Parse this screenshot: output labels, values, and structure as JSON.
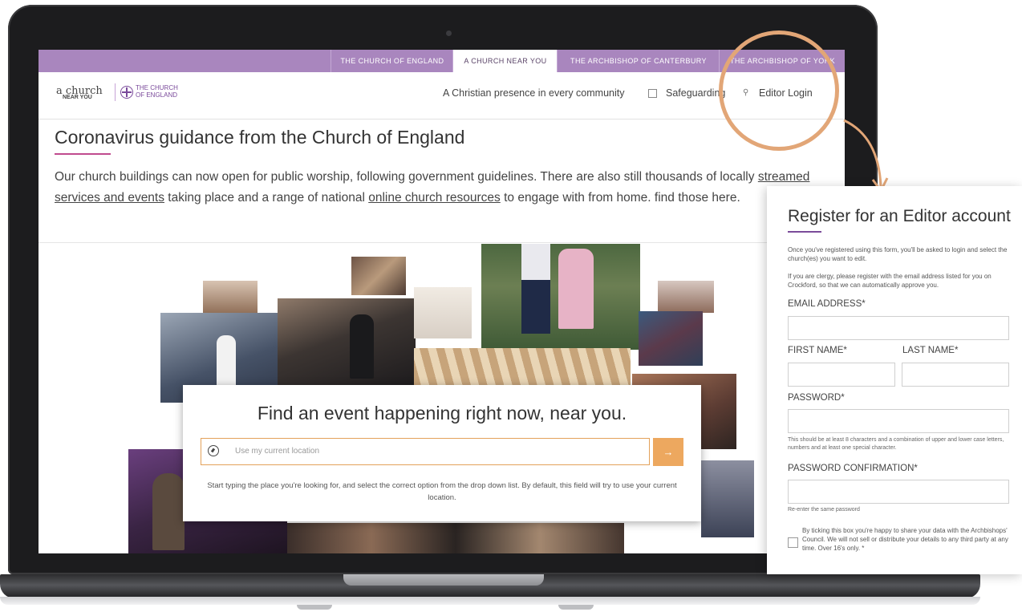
{
  "top_nav": {
    "tabs": [
      "THE CHURCH OF ENGLAND",
      "A CHURCH NEAR YOU",
      "THE ARCHBISHOP OF CANTERBURY",
      "THE ARCHBISHOP OF YORK"
    ],
    "active": "A CHURCH NEAR YOU"
  },
  "header": {
    "logo_main": "a church",
    "logo_sub": "NEAR YOU",
    "coe_logo_line1": "THE CHURCH",
    "coe_logo_line2": "OF ENGLAND",
    "tagline": "A Christian presence in every community",
    "safeguarding_label": "Safeguarding",
    "login_label": "Editor Login"
  },
  "covid": {
    "title": "Coronavirus guidance from the Church of England",
    "text_part1": "Our church buildings can now open for public worship, following government guidelines. There are also still thousands of locally ",
    "link1": "streamed services and events",
    "text_part2": " taking place and a range of national ",
    "link2": "online church resources",
    "text_part3": " to engage with from home. find those here."
  },
  "finder": {
    "title": "Find an event happening right now, near you.",
    "placeholder": "Use my current location",
    "go_icon": "→",
    "hint": "Start typing the place you're looking for, and select the correct option from the drop down list. By default, this field will try to use your current location."
  },
  "register": {
    "title": "Register for an Editor account",
    "intro1": "Once you've registered using this form, you'll be asked to login and select the church(es) you want to edit.",
    "intro2": "If you are clergy, please register with the email address listed for you on Crockford, so that we can automatically approve you.",
    "email_label": "EMAIL ADDRESS*",
    "first_name_label": "FIRST NAME*",
    "last_name_label": "LAST NAME*",
    "password_label": "PASSWORD*",
    "password_note": "This should be at least 8 characters and a combination of upper and lower case letters, numbers and at least one special character.",
    "password_confirm_label": "PASSWORD CONFIRMATION*",
    "confirm_note": "Re-enter the same password",
    "consent_text": "By ticking this box you're happy to share your data with the Archbishops' Council. We will not sell or distribute your details to any third party at any time. Over 16's only. *"
  },
  "colors": {
    "nav_purple": "#a986be",
    "accent_orange": "#e2a677",
    "coe_purple": "#7a4a9b",
    "title_underline": "#c04b8e"
  }
}
